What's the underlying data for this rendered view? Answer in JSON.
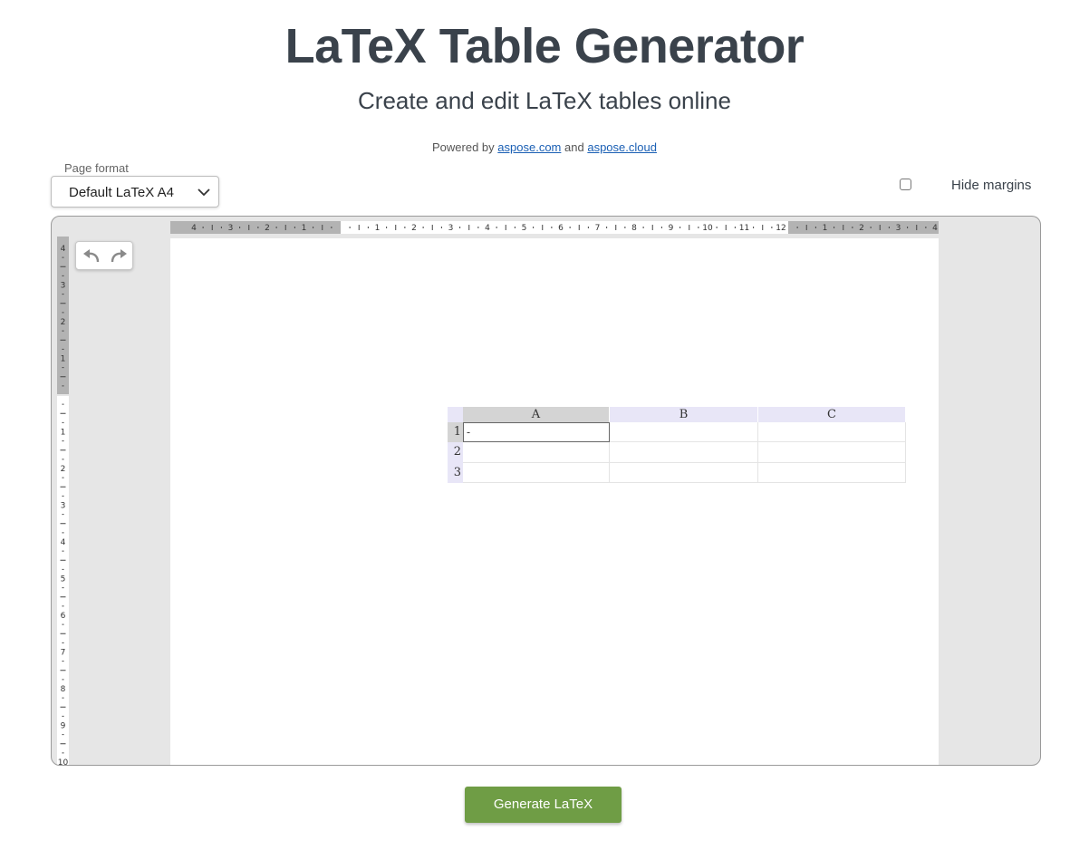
{
  "header": {
    "title": "LaTeX Table Generator",
    "subtitle": "Create and edit LaTeX tables online",
    "powered_prefix": "Powered by",
    "link1": "aspose.com",
    "and_text": "and",
    "link2": "aspose.cloud"
  },
  "page_format": {
    "label": "Page format",
    "selected": "Default LaTeX A4",
    "icon": "chevron-down-icon"
  },
  "hide_margins": {
    "label": "Hide margins",
    "checked": false
  },
  "toolbar": {
    "undo_icon": "undo-icon",
    "redo_icon": "redo-icon"
  },
  "rulers": {
    "horizontal_left_margin": [
      "4",
      "3",
      "2",
      "1"
    ],
    "horizontal_main": [
      "1",
      "2",
      "3",
      "4",
      "5",
      "6",
      "7",
      "8",
      "9",
      "10",
      "11",
      "12"
    ],
    "horizontal_right_margin": [
      "1",
      "2",
      "3",
      "4"
    ],
    "vertical_top_margin": [
      "4",
      "3",
      "2",
      "1"
    ],
    "vertical_main": [
      "1",
      "2",
      "3",
      "4",
      "5",
      "6",
      "7",
      "8",
      "9",
      "10"
    ]
  },
  "table": {
    "columns": [
      "A",
      "B",
      "C"
    ],
    "rows": [
      {
        "header": "1",
        "cells": [
          "-",
          "",
          ""
        ]
      },
      {
        "header": "2",
        "cells": [
          "",
          "",
          ""
        ]
      },
      {
        "header": "3",
        "cells": [
          "",
          "",
          ""
        ]
      }
    ],
    "selected_cell": "A1"
  },
  "actions": {
    "generate_label": "Generate LaTeX"
  },
  "colors": {
    "generate_button": "#6f9d45",
    "link": "#1a5fb4",
    "column_header": "#e8e6f7",
    "active_header": "#d4d4d4"
  }
}
